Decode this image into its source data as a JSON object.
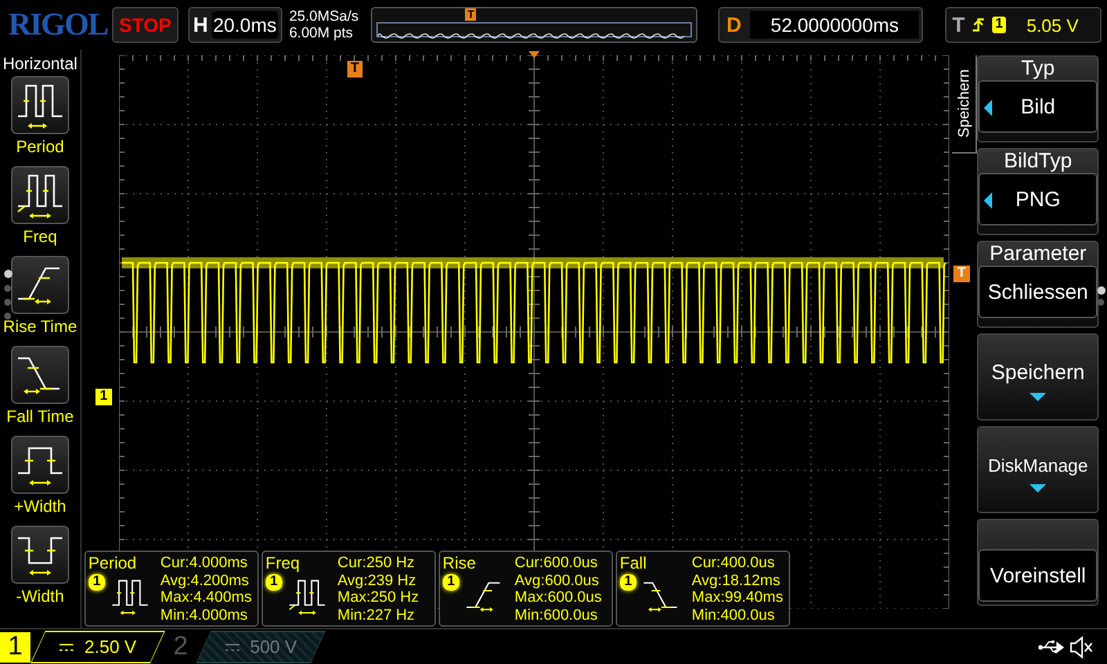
{
  "brand": {
    "logo": "RIGOL"
  },
  "run_state": {
    "label": "STOP"
  },
  "timebase": {
    "label": "H",
    "value": "20.0ms"
  },
  "acquisition": {
    "sample_rate": "25.0MSa/s",
    "memory_depth": "6.00M pts",
    "position_marker": "T"
  },
  "delay": {
    "label": "D",
    "value": "52.0000000ms"
  },
  "trigger": {
    "label": "T",
    "source": "1",
    "trigger_level": "5.05 V"
  },
  "left_menu": {
    "title": "Horizontal",
    "items": [
      {
        "kind": "period",
        "label": "Period"
      },
      {
        "kind": "freq",
        "label": "Freq"
      },
      {
        "kind": "rise",
        "label": "Rise Time"
      },
      {
        "kind": "fall",
        "label": "Fall Time"
      },
      {
        "kind": "pwidth",
        "label": "+Width"
      },
      {
        "kind": "nwidth",
        "label": "-Width"
      }
    ],
    "pages": [
      {
        "selected": true
      },
      {
        "selected": false
      },
      {
        "selected": false
      },
      {
        "selected": false
      }
    ]
  },
  "screen": {
    "position_marker": "T",
    "channel_marker": "1",
    "trigger_marker": "T"
  },
  "measurements": [
    {
      "kind": "period",
      "name": "Period",
      "source": "1",
      "lines": [
        "Cur:4.000ms",
        "Avg:4.200ms",
        "Max:4.400ms",
        "Min:4.000ms"
      ]
    },
    {
      "kind": "freq",
      "name": "Freq",
      "source": "1",
      "lines": [
        "Cur:250 Hz",
        "Avg:239 Hz",
        "Max:250 Hz",
        "Min:227 Hz"
      ]
    },
    {
      "kind": "rise",
      "name": "Rise",
      "source": "1",
      "lines": [
        "Cur:600.0us",
        "Avg:600.0us",
        "Max:600.0us",
        "Min:600.0us"
      ]
    },
    {
      "kind": "fall",
      "name": "Fall",
      "source": "1",
      "lines": [
        "Cur:400.0us",
        "Avg:18.12ms",
        "Max:99.40ms",
        "Min:400.0us"
      ]
    }
  ],
  "right_menu": {
    "tab": "Speichern",
    "items": [
      {
        "kind": "option",
        "title": "Typ",
        "value": "Bild"
      },
      {
        "kind": "option",
        "title": "BildTyp",
        "value": "PNG"
      },
      {
        "kind": "titled",
        "title": "Parameter",
        "value": "Schliessen"
      },
      {
        "kind": "submenu",
        "value": "Speichern"
      },
      {
        "kind": "submenu",
        "value": "DiskManage"
      },
      {
        "kind": "plain",
        "value": "Voreinstell"
      }
    ],
    "pages": [
      {
        "selected": true
      },
      {
        "selected": false
      }
    ]
  },
  "channels": [
    {
      "number": "1",
      "scale": "2.50 V",
      "selected": true
    },
    {
      "number": "2",
      "scale": "500 V",
      "selected": false
    }
  ]
}
